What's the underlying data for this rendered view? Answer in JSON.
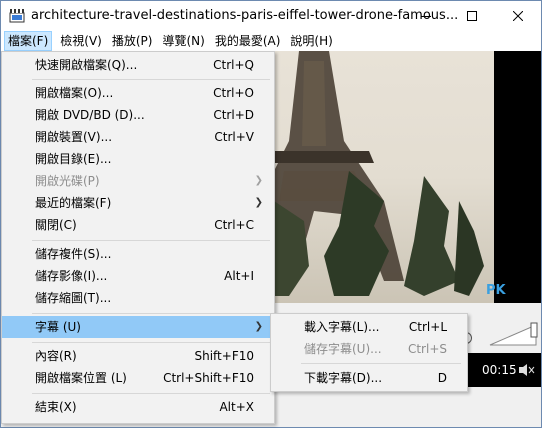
{
  "window": {
    "title": "architecture-travel-destinations-paris-eiffel-tower-drone-famous...",
    "app_icon": "clapperboard-icon",
    "controls": [
      "minimize-icon",
      "maximize-icon",
      "close-icon"
    ]
  },
  "menubar": {
    "items": [
      {
        "label": "檔案(F)",
        "active": true
      },
      {
        "label": "檢視(V)"
      },
      {
        "label": "播放(P)"
      },
      {
        "label": "導覽(N)"
      },
      {
        "label": "我的最愛(A)"
      },
      {
        "label": "說明(H)"
      }
    ]
  },
  "file_menu": {
    "items": [
      {
        "label": "快速開啟檔案(Q)...",
        "shortcut": "Ctrl+Q"
      },
      {
        "label": "開啟檔案(O)...",
        "shortcut": "Ctrl+O"
      },
      {
        "label": "開啟 DVD/BD (D)...",
        "shortcut": "Ctrl+D"
      },
      {
        "label": "開啟裝置(V)...",
        "shortcut": "Ctrl+V"
      },
      {
        "label": "開啟目錄(E)...",
        "shortcut": ""
      },
      {
        "label": "開啟光碟(P)",
        "shortcut": "",
        "submenu": true,
        "disabled": true
      },
      {
        "label": "最近的檔案(F)",
        "shortcut": "",
        "submenu": true
      },
      {
        "label": "關閉(C)",
        "shortcut": "Ctrl+C"
      },
      {
        "label": "儲存複件(S)...",
        "shortcut": ""
      },
      {
        "label": "儲存影像(I)...",
        "shortcut": "Alt+I"
      },
      {
        "label": "儲存縮圖(T)...",
        "shortcut": ""
      },
      {
        "label": "字幕 (U)",
        "shortcut": "",
        "submenu": true,
        "highlighted": true
      },
      {
        "label": "內容(R)",
        "shortcut": "Shift+F10"
      },
      {
        "label": "開啟檔案位置 (L)",
        "shortcut": "Ctrl+Shift+F10"
      },
      {
        "label": "結束(X)",
        "shortcut": "Alt+X"
      }
    ]
  },
  "subtitle_menu": {
    "items": [
      {
        "label": "載入字幕(L)...",
        "shortcut": "Ctrl+L"
      },
      {
        "label": "儲存字幕(U)...",
        "shortcut": "Ctrl+S",
        "disabled": true
      },
      {
        "label": "下載字幕(D)...",
        "shortcut": "D"
      }
    ]
  },
  "player": {
    "watermark": "PK",
    "time": "00:15",
    "volume_icon": "speaker-icon"
  }
}
